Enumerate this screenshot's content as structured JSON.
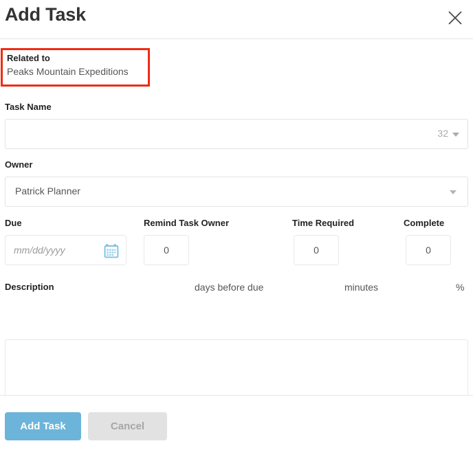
{
  "dialog": {
    "title": "Add Task",
    "close_icon": "close-icon"
  },
  "related": {
    "label": "Related to",
    "value": "Peaks Mountain Expeditions",
    "highlight_color": "#ee2b14"
  },
  "fields": {
    "task_name": {
      "label": "Task Name",
      "value": "",
      "placeholder": "",
      "char_count": "32"
    },
    "owner": {
      "label": "Owner",
      "value": "Patrick Planner"
    },
    "due": {
      "label": "Due",
      "value": "",
      "placeholder": "mm/dd/yyyy",
      "icon": "calendar-icon"
    },
    "remind": {
      "label": "Remind Task Owner",
      "value": "0",
      "unit": "days before due"
    },
    "time_required": {
      "label": "Time Required",
      "value": "0",
      "unit": "minutes"
    },
    "complete": {
      "label": "Complete",
      "value": "0",
      "unit": "%"
    },
    "description": {
      "label": "Description",
      "value": "",
      "placeholder": ""
    }
  },
  "footer": {
    "submit_label": "Add Task",
    "cancel_label": "Cancel",
    "submit_color": "#6cb4da",
    "cancel_color": "#e2e2e2"
  }
}
